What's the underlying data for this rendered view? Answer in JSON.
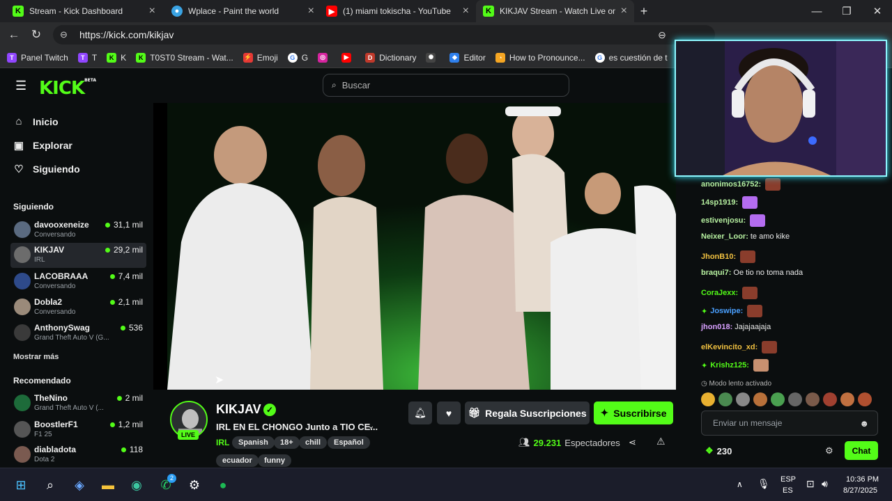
{
  "browser": {
    "tabs": [
      {
        "title": "Stream - Kick Dashboard",
        "active": false
      },
      {
        "title": "Wplace - Paint the world",
        "active": false
      },
      {
        "title": "(1) miami tokischa - YouTube",
        "active": false
      },
      {
        "title": "KIKJAV Stream - Watch Live on Kic",
        "active": true
      }
    ],
    "new_tab": "+",
    "url": "https://kick.com/kikjav",
    "bookmarks": [
      "Panel Twitch",
      "T",
      "K",
      "T0ST0 Stream - Wat...",
      "Emoji",
      "G",
      "",
      "",
      "Dictionary",
      "",
      "Editor",
      "How to Pronounce...",
      "es cuestión de t"
    ]
  },
  "kick": {
    "logo": "KICK",
    "logo_badge": "BETA",
    "search_placeholder": "Buscar",
    "nav": [
      {
        "label": "Inicio",
        "icon": "home-icon"
      },
      {
        "label": "Explorar",
        "icon": "explore-icon"
      },
      {
        "label": "Siguiendo",
        "icon": "heart-icon"
      }
    ],
    "following_heading": "Siguiendo",
    "following": [
      {
        "name": "davooxeneize",
        "category": "Conversando",
        "viewers": "31,1 mil"
      },
      {
        "name": "KIKJAV",
        "category": "IRL",
        "viewers": "29,2 mil",
        "selected": true
      },
      {
        "name": "LACOBRAAA",
        "category": "Conversando",
        "viewers": "7,4 mil"
      },
      {
        "name": "Dobla2",
        "category": "Conversando",
        "viewers": "2,1 mil"
      },
      {
        "name": "AnthonySwag",
        "category": "Grand Theft Auto V (G...",
        "viewers": "536"
      }
    ],
    "show_more": "Mostrar más",
    "recommended_heading": "Recomendado",
    "recommended": [
      {
        "name": "TheNino",
        "category": "Grand Theft Auto V (...",
        "viewers": "2 mil"
      },
      {
        "name": "BoostlerF1",
        "category": "F1 25",
        "viewers": "1,2 mil"
      },
      {
        "name": "diabladota",
        "category": "Dota 2",
        "viewers": "118"
      }
    ]
  },
  "stream": {
    "channel": "KIKJAV",
    "live": "LIVE",
    "title": "IRL EN EL CHONGO Junto a TIO CE...",
    "category": "IRL",
    "tags": [
      "Spanish",
      "18+",
      "chill",
      "Español",
      "ecuador",
      "funny"
    ],
    "gift_label": "Regala Suscripciones",
    "subscribe_label": "Suscribirse",
    "viewers": "29.231",
    "viewers_label": "Espectadores"
  },
  "chat": {
    "messages": [
      {
        "user": "anonimos16752:",
        "text": "",
        "color": "#b6f0a0",
        "emote": "#8a3d2c"
      },
      {
        "user": "14sp1919:",
        "text": "",
        "color": "#b6f0a0",
        "emote": "#b46cf0"
      },
      {
        "user": "estivenjosu:",
        "text": "",
        "color": "#b6f0a0",
        "emote": "#b46cf0"
      },
      {
        "user": "Neixer_Loor:",
        "text": "te amo kike",
        "color": "#b6f0a0",
        "emote": ""
      },
      {
        "user": "JhonB10:",
        "text": "",
        "color": "#f0c040",
        "emote": "#8a3d2c"
      },
      {
        "user": "braqui7:",
        "text": "Oe tio no toma nada",
        "color": "#b6f0a0",
        "emote": ""
      },
      {
        "user": "CoraJexx:",
        "text": "",
        "color": "#53fc18",
        "emote": "#8a3d2c"
      },
      {
        "user": "Joswipe:",
        "text": "",
        "color": "#4aa0ff",
        "emote": "#8a3d2c"
      },
      {
        "user": "jhon018:",
        "text": "Jajajaajaja",
        "color": "#d8a0ff",
        "emote": ""
      },
      {
        "user": "elKevincito_xd:",
        "text": "",
        "color": "#f0c040",
        "emote": "#8a3d2c"
      },
      {
        "user": "Krishz125:",
        "text": "",
        "color": "#53fc18",
        "emote": "#c89070"
      }
    ],
    "slow_mode": "Modo lento activado",
    "input_placeholder": "Enviar un mensaje",
    "points": "230",
    "chat_button": "Chat"
  },
  "taskbar": {
    "language": "ESP",
    "language_sub": "ES",
    "time": "10:36 PM",
    "date": "8/27/2025",
    "whatsapp_badge": "2"
  },
  "colors": {
    "kick_green": "#53fc18",
    "bg": "#0b0e0f"
  }
}
